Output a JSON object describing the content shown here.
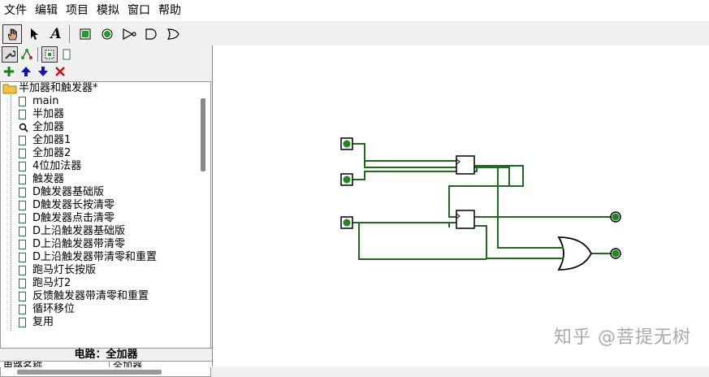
{
  "menu": {
    "items": [
      "文件",
      "编辑",
      "项目",
      "模拟",
      "窗口",
      "帮助"
    ]
  },
  "toolbar": {
    "text_tool_glyph": "A"
  },
  "project": {
    "root_label": "半加器和触发器*",
    "circuits": [
      "main",
      "半加器",
      "全加器",
      "全加器1",
      "全加器2",
      "4位加法器",
      "触发器",
      "D触发器基础版",
      "D触发器长按清零",
      "D触发器点击清零",
      "D上沿触发器基础版",
      "D上沿触发器带清零",
      "D上沿触发器带清零和重置",
      "跑马灯长按版",
      "跑马灯2",
      "反馈触发器带清零和重置",
      "循环移位",
      "复用"
    ],
    "selected_index": 2
  },
  "circuit_panel": {
    "label": "电路：全加器",
    "attr_name_header": "电路名称",
    "attr_value": "全加器"
  },
  "watermark": "知乎 @菩提无树",
  "colors": {
    "wire": "#1e6b1e",
    "pin_fill": "#1e8a1e",
    "accent_blue": "#1010c0",
    "delete_red": "#cc1010",
    "add_green": "#108010"
  }
}
